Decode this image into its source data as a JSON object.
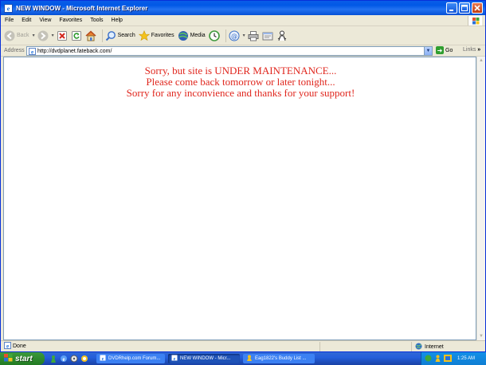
{
  "window": {
    "title": "NEW WINDOW - Microsoft Internet Explorer"
  },
  "menu": [
    "File",
    "Edit",
    "View",
    "Favorites",
    "Tools",
    "Help"
  ],
  "toolbar": {
    "back": "Back",
    "search": "Search",
    "favorites": "Favorites",
    "media": "Media"
  },
  "address": {
    "label": "Address",
    "url": "http://dvdplanet.fateback.com/",
    "go": "Go",
    "links": "Links"
  },
  "page": {
    "line1": "Sorry, but site is UNDER MAINTENANCE...",
    "line2": "Please come back tomorrow or later tonight...",
    "line3": "Sorry for any inconvience and thanks for your support!",
    "text_color": "#e0261d"
  },
  "status": {
    "text": "Done",
    "zone": "Internet"
  },
  "taskbar": {
    "start": "start",
    "tasks": [
      {
        "label": "DVDRhelp.com Forum..."
      },
      {
        "label": "NEW WINDOW - Micr..."
      },
      {
        "label": "Eag1822's Buddy List ..."
      }
    ],
    "clock": "1:25 AM"
  },
  "colors": {
    "title_blue": "#0058e6",
    "taskbar_blue": "#245edb",
    "start_green": "#2f8a2f"
  }
}
